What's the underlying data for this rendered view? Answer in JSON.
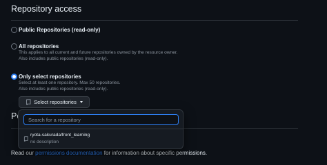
{
  "section": {
    "title": "Repository access"
  },
  "options": {
    "public": {
      "label": "Public Repositories (read-only)"
    },
    "all": {
      "label": "All repositories",
      "desc_line1": "This applies to all current and future repositories owned by the resource owner.",
      "desc_line2": "Also includes public repositories (read-only)."
    },
    "select": {
      "label": "Only select repositories",
      "desc_line1": "Select at least one repository. Max 50 repositories.",
      "desc_line2": "Also includes public repositories (read-only)."
    }
  },
  "select_button": {
    "label": "Select repositories"
  },
  "dropdown": {
    "search_placeholder": "Search for a repository",
    "repo": {
      "name": "ryota-sakurada/front_learning",
      "description": "no description"
    }
  },
  "permissions": {
    "heading_partial": "Pe",
    "footer_prefix": "Read our ",
    "footer_link": "permissions documentation",
    "footer_suffix": " for information about specific permissions."
  },
  "colors": {
    "background": "#0d1117",
    "accent": "#2f81f7",
    "muted_text": "#8b949e",
    "border": "#30363d"
  }
}
